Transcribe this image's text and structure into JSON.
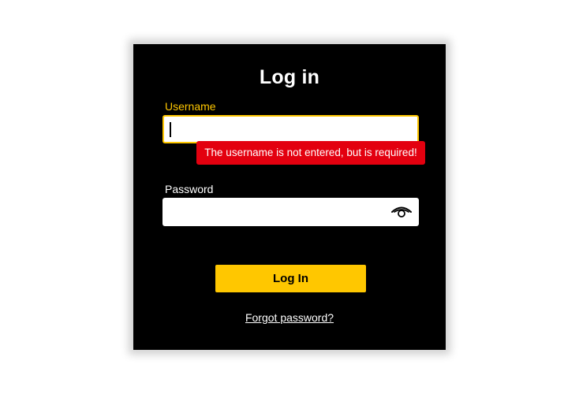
{
  "login": {
    "title": "Log in",
    "username_label": "Username",
    "username_value": "",
    "username_error": "The username is not entered, but is required!",
    "password_label": "Password",
    "password_value": "",
    "submit_label": "Log In",
    "forgot_label": "Forgot password?"
  },
  "icons": {
    "password_toggle": "eye-icon"
  },
  "colors": {
    "card_background": "#000000",
    "accent": "#ffc700",
    "error": "#e3000f",
    "text_light": "#ffffff"
  }
}
